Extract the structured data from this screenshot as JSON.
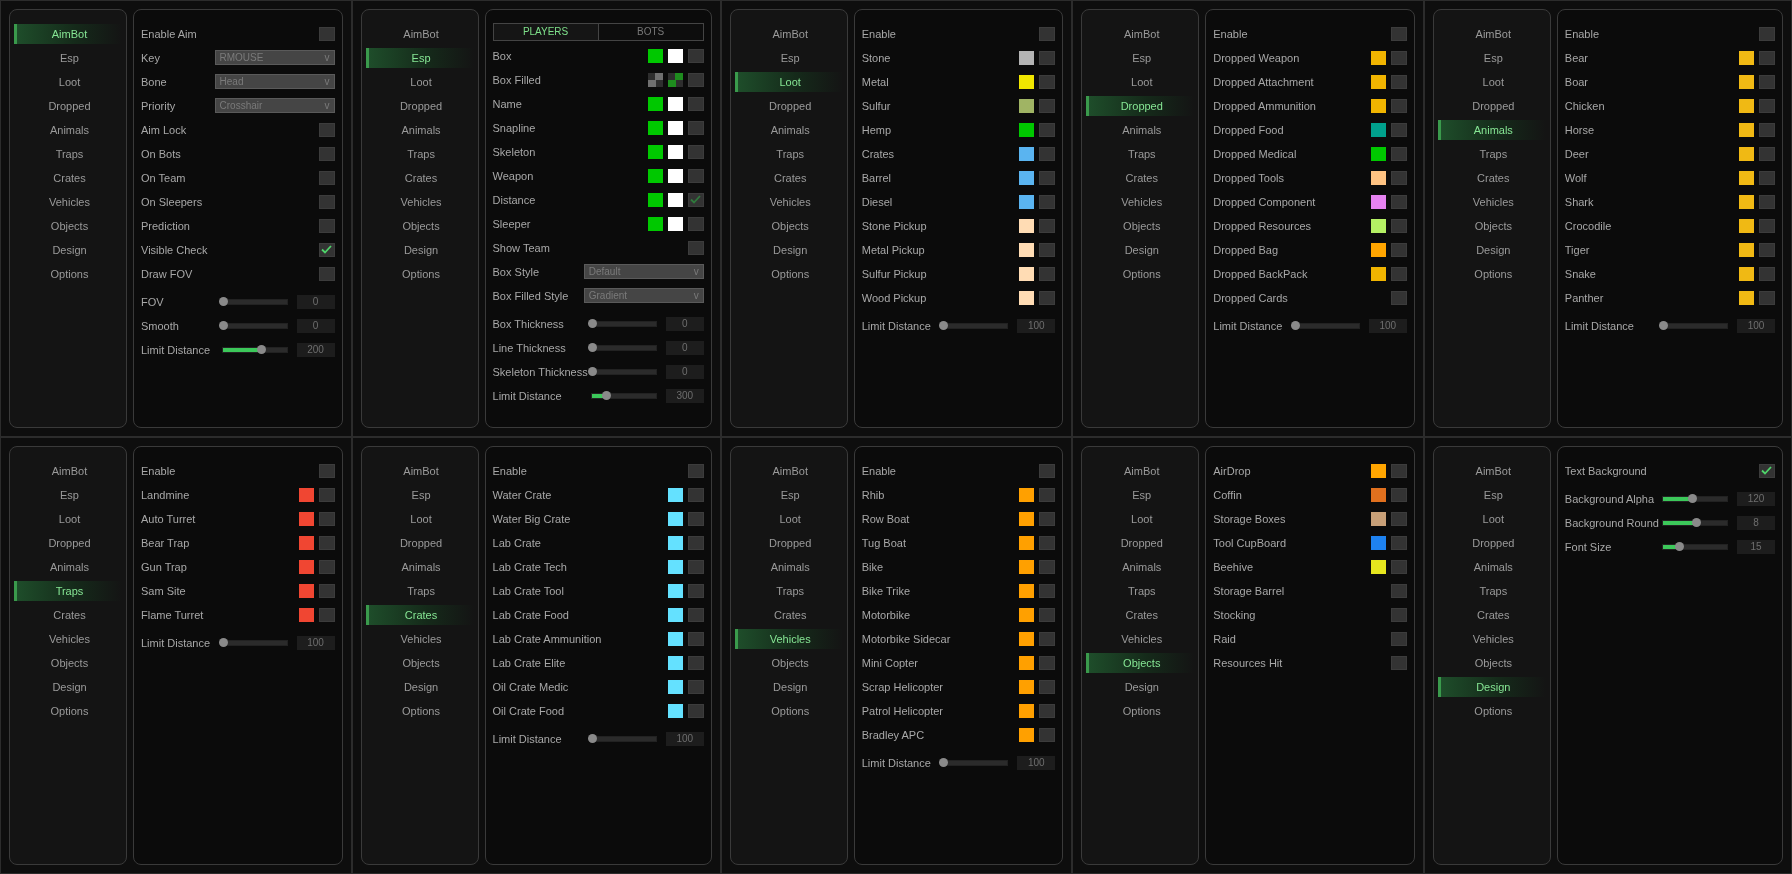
{
  "panels": [
    {
      "menu": [
        {
          "label": "AimBot",
          "selected": true
        },
        {
          "label": "Esp",
          "selected": false
        },
        {
          "label": "Loot",
          "selected": false
        },
        {
          "label": "Dropped",
          "selected": false
        },
        {
          "label": "Animals",
          "selected": false
        },
        {
          "label": "Traps",
          "selected": false
        },
        {
          "label": "Crates",
          "selected": false
        },
        {
          "label": "Vehicles",
          "selected": false
        },
        {
          "label": "Objects",
          "selected": false
        },
        {
          "label": "Design",
          "selected": false
        },
        {
          "label": "Options",
          "selected": false
        }
      ],
      "rows": [
        {
          "kind": "checkbox",
          "label": "Enable Aim",
          "checked": false
        },
        {
          "kind": "dropdown",
          "label": "Key",
          "value": "RMOUSE",
          "caret": "v"
        },
        {
          "kind": "dropdown",
          "label": "Bone",
          "value": "Head",
          "caret": "v"
        },
        {
          "kind": "dropdown",
          "label": "Priority",
          "value": "Crosshair",
          "caret": "v"
        },
        {
          "kind": "checkbox",
          "label": "Aim Lock",
          "checked": false
        },
        {
          "kind": "checkbox",
          "label": "On Bots",
          "checked": false
        },
        {
          "kind": "checkbox",
          "label": "On Team",
          "checked": false
        },
        {
          "kind": "checkbox",
          "label": "On Sleepers",
          "checked": false
        },
        {
          "kind": "checkbox",
          "label": "Prediction",
          "checked": false
        },
        {
          "kind": "checkbox",
          "label": "Visible Check",
          "checked": true
        },
        {
          "kind": "checkbox",
          "label": "Draw FOV",
          "checked": false
        },
        {
          "kind": "slider",
          "label": "FOV",
          "level": 0,
          "reading": "0"
        },
        {
          "kind": "slider",
          "label": "Smooth",
          "level": 0,
          "reading": "0"
        },
        {
          "kind": "slider",
          "label": "Limit Distance",
          "level": 0.6,
          "reading": "200"
        }
      ]
    },
    {
      "menu": [
        {
          "label": "AimBot",
          "selected": false
        },
        {
          "label": "Esp",
          "selected": true
        },
        {
          "label": "Loot",
          "selected": false
        },
        {
          "label": "Dropped",
          "selected": false
        },
        {
          "label": "Animals",
          "selected": false
        },
        {
          "label": "Traps",
          "selected": false
        },
        {
          "label": "Crates",
          "selected": false
        },
        {
          "label": "Vehicles",
          "selected": false
        },
        {
          "label": "Objects",
          "selected": false
        },
        {
          "label": "Design",
          "selected": false
        },
        {
          "label": "Options",
          "selected": false
        }
      ],
      "tabs": [
        {
          "label": "PLAYERS",
          "selected": true
        },
        {
          "label": "BOTS",
          "selected": false
        }
      ],
      "rows": [
        {
          "kind": "colors",
          "label": "Box",
          "swatches": [
            {
              "kind": "solid",
              "color": "#00c800"
            },
            {
              "kind": "solid",
              "color": "#ffffff"
            }
          ],
          "checked": false
        },
        {
          "kind": "colors",
          "label": "Box Filled",
          "swatches": [
            {
              "kind": "checker",
              "color": "#707070"
            },
            {
              "kind": "checker",
              "color": "#1e8c1e"
            }
          ],
          "checked": false
        },
        {
          "kind": "colors",
          "label": "Name",
          "swatches": [
            {
              "kind": "solid",
              "color": "#00c800"
            },
            {
              "kind": "solid",
              "color": "#ffffff"
            }
          ],
          "checked": false
        },
        {
          "kind": "colors",
          "label": "Snapline",
          "swatches": [
            {
              "kind": "solid",
              "color": "#00c800"
            },
            {
              "kind": "solid",
              "color": "#ffffff"
            }
          ],
          "checked": false
        },
        {
          "kind": "colors",
          "label": "Skeleton",
          "swatches": [
            {
              "kind": "solid",
              "color": "#00c800"
            },
            {
              "kind": "solid",
              "color": "#ffffff"
            }
          ],
          "checked": false
        },
        {
          "kind": "colors",
          "label": "Weapon",
          "swatches": [
            {
              "kind": "solid",
              "color": "#00c800"
            },
            {
              "kind": "solid",
              "color": "#ffffff"
            }
          ],
          "checked": false
        },
        {
          "kind": "colors",
          "label": "Distance",
          "swatches": [
            {
              "kind": "solid",
              "color": "#00c800"
            },
            {
              "kind": "solid",
              "color": "#ffffff"
            }
          ],
          "checked": true
        },
        {
          "kind": "colors",
          "label": "Sleeper",
          "swatches": [
            {
              "kind": "solid",
              "color": "#00c800"
            },
            {
              "kind": "solid",
              "color": "#ffffff"
            }
          ],
          "checked": false
        },
        {
          "kind": "checkbox",
          "label": "Show Team",
          "checked": false
        },
        {
          "kind": "dropdown",
          "label": "Box Style",
          "value": "Default",
          "caret": "v"
        },
        {
          "kind": "dropdown",
          "label": "Box Filled Style",
          "value": "Gradient",
          "caret": "v"
        },
        {
          "kind": "slider",
          "label": "Box Thickness",
          "level": 0,
          "reading": "0"
        },
        {
          "kind": "slider",
          "label": "Line Thickness",
          "level": 0,
          "reading": "0"
        },
        {
          "kind": "slider",
          "label": "Skeleton Thickness",
          "level": 0,
          "reading": "0"
        },
        {
          "kind": "slider",
          "label": "Limit Distance",
          "level": 0.22,
          "reading": "300"
        }
      ]
    },
    {
      "menu": [
        {
          "label": "AimBot",
          "selected": false
        },
        {
          "label": "Esp",
          "selected": false
        },
        {
          "label": "Loot",
          "selected": true
        },
        {
          "label": "Dropped",
          "selected": false
        },
        {
          "label": "Animals",
          "selected": false
        },
        {
          "label": "Traps",
          "selected": false
        },
        {
          "label": "Crates",
          "selected": false
        },
        {
          "label": "Vehicles",
          "selected": false
        },
        {
          "label": "Objects",
          "selected": false
        },
        {
          "label": "Design",
          "selected": false
        },
        {
          "label": "Options",
          "selected": false
        }
      ],
      "rows": [
        {
          "kind": "checkbox",
          "label": "Enable",
          "checked": false
        },
        {
          "kind": "colors",
          "label": "Stone",
          "swatches": [
            {
              "kind": "solid",
              "color": "#b4b4b4"
            }
          ],
          "checked": false
        },
        {
          "kind": "colors",
          "label": "Metal",
          "swatches": [
            {
              "kind": "solid",
              "color": "#f0e600"
            }
          ],
          "checked": false
        },
        {
          "kind": "colors",
          "label": "Sulfur",
          "swatches": [
            {
              "kind": "solid",
              "color": "#a0b464"
            }
          ],
          "checked": false
        },
        {
          "kind": "colors",
          "label": "Hemp",
          "swatches": [
            {
              "kind": "solid",
              "color": "#00c800"
            }
          ],
          "checked": false
        },
        {
          "kind": "colors",
          "label": "Crates",
          "swatches": [
            {
              "kind": "solid",
              "color": "#5ab4f0"
            }
          ],
          "checked": false
        },
        {
          "kind": "colors",
          "label": "Barrel",
          "swatches": [
            {
              "kind": "solid",
              "color": "#5ab4f0"
            }
          ],
          "checked": false
        },
        {
          "kind": "colors",
          "label": "Diesel",
          "swatches": [
            {
              "kind": "solid",
              "color": "#5ab4f0"
            }
          ],
          "checked": false
        },
        {
          "kind": "colors",
          "label": "Stone Pickup",
          "swatches": [
            {
              "kind": "solid",
              "color": "#ffdcb4"
            }
          ],
          "checked": false
        },
        {
          "kind": "colors",
          "label": "Metal Pickup",
          "swatches": [
            {
              "kind": "solid",
              "color": "#ffdcb4"
            }
          ],
          "checked": false
        },
        {
          "kind": "colors",
          "label": "Sulfur Pickup",
          "swatches": [
            {
              "kind": "solid",
              "color": "#ffdcb4"
            }
          ],
          "checked": false
        },
        {
          "kind": "colors",
          "label": "Wood Pickup",
          "swatches": [
            {
              "kind": "solid",
              "color": "#ffdcb4"
            }
          ],
          "checked": false
        },
        {
          "kind": "slider",
          "label": "Limit Distance",
          "level": 0,
          "reading": "100"
        }
      ]
    },
    {
      "menu": [
        {
          "label": "AimBot",
          "selected": false
        },
        {
          "label": "Esp",
          "selected": false
        },
        {
          "label": "Loot",
          "selected": false
        },
        {
          "label": "Dropped",
          "selected": true
        },
        {
          "label": "Animals",
          "selected": false
        },
        {
          "label": "Traps",
          "selected": false
        },
        {
          "label": "Crates",
          "selected": false
        },
        {
          "label": "Vehicles",
          "selected": false
        },
        {
          "label": "Objects",
          "selected": false
        },
        {
          "label": "Design",
          "selected": false
        },
        {
          "label": "Options",
          "selected": false
        }
      ],
      "rows": [
        {
          "kind": "checkbox",
          "label": "Enable",
          "checked": false
        },
        {
          "kind": "colors",
          "label": "Dropped Weapon",
          "swatches": [
            {
              "kind": "solid",
              "color": "#f0b400"
            }
          ],
          "checked": false
        },
        {
          "kind": "colors",
          "label": "Dropped Attachment",
          "swatches": [
            {
              "kind": "solid",
              "color": "#f0b400"
            }
          ],
          "checked": false
        },
        {
          "kind": "colors",
          "label": "Dropped Ammunition",
          "swatches": [
            {
              "kind": "solid",
              "color": "#f0b400"
            }
          ],
          "checked": false
        },
        {
          "kind": "colors",
          "label": "Dropped Food",
          "swatches": [
            {
              "kind": "solid",
              "color": "#00a08c"
            }
          ],
          "checked": false
        },
        {
          "kind": "colors",
          "label": "Dropped Medical",
          "swatches": [
            {
              "kind": "solid",
              "color": "#00c800"
            }
          ],
          "checked": false
        },
        {
          "kind": "colors",
          "label": "Dropped Tools",
          "swatches": [
            {
              "kind": "solid",
              "color": "#ffc382"
            }
          ],
          "checked": false
        },
        {
          "kind": "colors",
          "label": "Dropped Component",
          "swatches": [
            {
              "kind": "solid",
              "color": "#e682f0"
            }
          ],
          "checked": false
        },
        {
          "kind": "colors",
          "label": "Dropped Resources",
          "swatches": [
            {
              "kind": "solid",
              "color": "#b4f064"
            }
          ],
          "checked": false
        },
        {
          "kind": "colors",
          "label": "Dropped Bag",
          "swatches": [
            {
              "kind": "solid",
              "color": "#ffa500"
            }
          ],
          "checked": false
        },
        {
          "kind": "colors",
          "label": "Dropped BackPack",
          "swatches": [
            {
              "kind": "solid",
              "color": "#f0b400"
            }
          ],
          "checked": false
        },
        {
          "kind": "checkbox",
          "label": "Dropped Cards",
          "checked": false
        },
        {
          "kind": "slider",
          "label": "Limit Distance",
          "level": 0,
          "reading": "100"
        }
      ]
    },
    {
      "menu": [
        {
          "label": "AimBot",
          "selected": false
        },
        {
          "label": "Esp",
          "selected": false
        },
        {
          "label": "Loot",
          "selected": false
        },
        {
          "label": "Dropped",
          "selected": false
        },
        {
          "label": "Animals",
          "selected": true
        },
        {
          "label": "Traps",
          "selected": false
        },
        {
          "label": "Crates",
          "selected": false
        },
        {
          "label": "Vehicles",
          "selected": false
        },
        {
          "label": "Objects",
          "selected": false
        },
        {
          "label": "Design",
          "selected": false
        },
        {
          "label": "Options",
          "selected": false
        }
      ],
      "rows": [
        {
          "kind": "checkbox",
          "label": "Enable",
          "checked": false
        },
        {
          "kind": "colors",
          "label": "Bear",
          "swatches": [
            {
              "kind": "solid",
              "color": "#f0b914"
            }
          ],
          "checked": false
        },
        {
          "kind": "colors",
          "label": "Boar",
          "swatches": [
            {
              "kind": "solid",
              "color": "#f0b914"
            }
          ],
          "checked": false
        },
        {
          "kind": "colors",
          "label": "Chicken",
          "swatches": [
            {
              "kind": "solid",
              "color": "#f0b914"
            }
          ],
          "checked": false
        },
        {
          "kind": "colors",
          "label": "Horse",
          "swatches": [
            {
              "kind": "solid",
              "color": "#f0b914"
            }
          ],
          "checked": false
        },
        {
          "kind": "colors",
          "label": "Deer",
          "swatches": [
            {
              "kind": "solid",
              "color": "#f0b914"
            }
          ],
          "checked": false
        },
        {
          "kind": "colors",
          "label": "Wolf",
          "swatches": [
            {
              "kind": "solid",
              "color": "#f0b914"
            }
          ],
          "checked": false
        },
        {
          "kind": "colors",
          "label": "Shark",
          "swatches": [
            {
              "kind": "solid",
              "color": "#f0b914"
            }
          ],
          "checked": false
        },
        {
          "kind": "colors",
          "label": "Crocodile",
          "swatches": [
            {
              "kind": "solid",
              "color": "#f0b914"
            }
          ],
          "checked": false
        },
        {
          "kind": "colors",
          "label": "Tiger",
          "swatches": [
            {
              "kind": "solid",
              "color": "#f0b914"
            }
          ],
          "checked": false
        },
        {
          "kind": "colors",
          "label": "Snake",
          "swatches": [
            {
              "kind": "solid",
              "color": "#f0b914"
            }
          ],
          "checked": false
        },
        {
          "kind": "colors",
          "label": "Panther",
          "swatches": [
            {
              "kind": "solid",
              "color": "#f0b914"
            }
          ],
          "checked": false
        },
        {
          "kind": "slider",
          "label": "Limit Distance",
          "level": 0,
          "reading": "100"
        }
      ]
    },
    {
      "menu": [
        {
          "label": "AimBot",
          "selected": false
        },
        {
          "label": "Esp",
          "selected": false
        },
        {
          "label": "Loot",
          "selected": false
        },
        {
          "label": "Dropped",
          "selected": false
        },
        {
          "label": "Animals",
          "selected": false
        },
        {
          "label": "Traps",
          "selected": true
        },
        {
          "label": "Crates",
          "selected": false
        },
        {
          "label": "Vehicles",
          "selected": false
        },
        {
          "label": "Objects",
          "selected": false
        },
        {
          "label": "Design",
          "selected": false
        },
        {
          "label": "Options",
          "selected": false
        }
      ],
      "rows": [
        {
          "kind": "checkbox",
          "label": "Enable",
          "checked": false
        },
        {
          "kind": "colors",
          "label": "Landmine",
          "swatches": [
            {
              "kind": "solid",
              "color": "#f04632"
            }
          ],
          "checked": false
        },
        {
          "kind": "colors",
          "label": "Auto Turret",
          "swatches": [
            {
              "kind": "solid",
              "color": "#f04632"
            }
          ],
          "checked": false
        },
        {
          "kind": "colors",
          "label": "Bear Trap",
          "swatches": [
            {
              "kind": "solid",
              "color": "#f04632"
            }
          ],
          "checked": false
        },
        {
          "kind": "colors",
          "label": "Gun Trap",
          "swatches": [
            {
              "kind": "solid",
              "color": "#f04632"
            }
          ],
          "checked": false
        },
        {
          "kind": "colors",
          "label": "Sam Site",
          "swatches": [
            {
              "kind": "solid",
              "color": "#f04632"
            }
          ],
          "checked": false
        },
        {
          "kind": "colors",
          "label": "Flame Turret",
          "swatches": [
            {
              "kind": "solid",
              "color": "#f04632"
            }
          ],
          "checked": false
        },
        {
          "kind": "slider",
          "label": "Limit Distance",
          "level": 0,
          "reading": "100"
        }
      ]
    },
    {
      "menu": [
        {
          "label": "AimBot",
          "selected": false
        },
        {
          "label": "Esp",
          "selected": false
        },
        {
          "label": "Loot",
          "selected": false
        },
        {
          "label": "Dropped",
          "selected": false
        },
        {
          "label": "Animals",
          "selected": false
        },
        {
          "label": "Traps",
          "selected": false
        },
        {
          "label": "Crates",
          "selected": true
        },
        {
          "label": "Vehicles",
          "selected": false
        },
        {
          "label": "Objects",
          "selected": false
        },
        {
          "label": "Design",
          "selected": false
        },
        {
          "label": "Options",
          "selected": false
        }
      ],
      "rows": [
        {
          "kind": "checkbox",
          "label": "Enable",
          "checked": false
        },
        {
          "kind": "colors",
          "label": "Water Crate",
          "swatches": [
            {
              "kind": "solid",
              "color": "#64e1ff"
            }
          ],
          "checked": false
        },
        {
          "kind": "colors",
          "label": "Water Big Crate",
          "swatches": [
            {
              "kind": "solid",
              "color": "#64e1ff"
            }
          ],
          "checked": false
        },
        {
          "kind": "colors",
          "label": "Lab Crate",
          "swatches": [
            {
              "kind": "solid",
              "color": "#64e1ff"
            }
          ],
          "checked": false
        },
        {
          "kind": "colors",
          "label": "Lab Crate Tech",
          "swatches": [
            {
              "kind": "solid",
              "color": "#64e1ff"
            }
          ],
          "checked": false
        },
        {
          "kind": "colors",
          "label": "Lab Crate Tool",
          "swatches": [
            {
              "kind": "solid",
              "color": "#64e1ff"
            }
          ],
          "checked": false
        },
        {
          "kind": "colors",
          "label": "Lab Crate Food",
          "swatches": [
            {
              "kind": "solid",
              "color": "#64e1ff"
            }
          ],
          "checked": false
        },
        {
          "kind": "colors",
          "label": "Lab Crate Ammunition",
          "swatches": [
            {
              "kind": "solid",
              "color": "#64e1ff"
            }
          ],
          "checked": false
        },
        {
          "kind": "colors",
          "label": "Lab Crate Elite",
          "swatches": [
            {
              "kind": "solid",
              "color": "#64e1ff"
            }
          ],
          "checked": false
        },
        {
          "kind": "colors",
          "label": "Oil Crate Medic",
          "swatches": [
            {
              "kind": "solid",
              "color": "#64e1ff"
            }
          ],
          "checked": false
        },
        {
          "kind": "colors",
          "label": "Oil Crate Food",
          "swatches": [
            {
              "kind": "solid",
              "color": "#64e1ff"
            }
          ],
          "checked": false
        },
        {
          "kind": "slider",
          "label": "Limit Distance",
          "level": 0,
          "reading": "100"
        }
      ]
    },
    {
      "menu": [
        {
          "label": "AimBot",
          "selected": false
        },
        {
          "label": "Esp",
          "selected": false
        },
        {
          "label": "Loot",
          "selected": false
        },
        {
          "label": "Dropped",
          "selected": false
        },
        {
          "label": "Animals",
          "selected": false
        },
        {
          "label": "Traps",
          "selected": false
        },
        {
          "label": "Crates",
          "selected": false
        },
        {
          "label": "Vehicles",
          "selected": true
        },
        {
          "label": "Objects",
          "selected": false
        },
        {
          "label": "Design",
          "selected": false
        },
        {
          "label": "Options",
          "selected": false
        }
      ],
      "rows": [
        {
          "kind": "checkbox",
          "label": "Enable",
          "checked": false
        },
        {
          "kind": "colors",
          "label": "Rhib",
          "swatches": [
            {
              "kind": "solid",
              "color": "#ffa000"
            }
          ],
          "checked": false
        },
        {
          "kind": "colors",
          "label": "Row Boat",
          "swatches": [
            {
              "kind": "solid",
              "color": "#ffa000"
            }
          ],
          "checked": false
        },
        {
          "kind": "colors",
          "label": "Tug Boat",
          "swatches": [
            {
              "kind": "solid",
              "color": "#ffa000"
            }
          ],
          "checked": false
        },
        {
          "kind": "colors",
          "label": "Bike",
          "swatches": [
            {
              "kind": "solid",
              "color": "#ffa000"
            }
          ],
          "checked": false
        },
        {
          "kind": "colors",
          "label": "Bike Trike",
          "swatches": [
            {
              "kind": "solid",
              "color": "#ffa000"
            }
          ],
          "checked": false
        },
        {
          "kind": "colors",
          "label": "Motorbike",
          "swatches": [
            {
              "kind": "solid",
              "color": "#ffa000"
            }
          ],
          "checked": false
        },
        {
          "kind": "colors",
          "label": "Motorbike Sidecar",
          "swatches": [
            {
              "kind": "solid",
              "color": "#ffa000"
            }
          ],
          "checked": false
        },
        {
          "kind": "colors",
          "label": "Mini Copter",
          "swatches": [
            {
              "kind": "solid",
              "color": "#ffa000"
            }
          ],
          "checked": false
        },
        {
          "kind": "colors",
          "label": "Scrap Helicopter",
          "swatches": [
            {
              "kind": "solid",
              "color": "#ffa000"
            }
          ],
          "checked": false
        },
        {
          "kind": "colors",
          "label": "Patrol Helicopter",
          "swatches": [
            {
              "kind": "solid",
              "color": "#ffa000"
            }
          ],
          "checked": false
        },
        {
          "kind": "colors",
          "label": "Bradley APC",
          "swatches": [
            {
              "kind": "solid",
              "color": "#ffa000"
            }
          ],
          "checked": false
        },
        {
          "kind": "slider",
          "label": "Limit Distance",
          "level": 0,
          "reading": "100"
        }
      ]
    },
    {
      "menu": [
        {
          "label": "AimBot",
          "selected": false
        },
        {
          "label": "Esp",
          "selected": false
        },
        {
          "label": "Loot",
          "selected": false
        },
        {
          "label": "Dropped",
          "selected": false
        },
        {
          "label": "Animals",
          "selected": false
        },
        {
          "label": "Traps",
          "selected": false
        },
        {
          "label": "Crates",
          "selected": false
        },
        {
          "label": "Vehicles",
          "selected": false
        },
        {
          "label": "Objects",
          "selected": true
        },
        {
          "label": "Design",
          "selected": false
        },
        {
          "label": "Options",
          "selected": false
        }
      ],
      "rows": [
        {
          "kind": "colors",
          "label": "AirDrop",
          "swatches": [
            {
              "kind": "solid",
              "color": "#ffa500"
            }
          ],
          "checked": false
        },
        {
          "kind": "colors",
          "label": "Coffin",
          "swatches": [
            {
              "kind": "solid",
              "color": "#e0701e"
            }
          ],
          "checked": false
        },
        {
          "kind": "colors",
          "label": "Storage Boxes",
          "swatches": [
            {
              "kind": "solid",
              "color": "#c8a078"
            }
          ],
          "checked": false
        },
        {
          "kind": "colors",
          "label": "Tool CupBoard",
          "swatches": [
            {
              "kind": "solid",
              "color": "#1e82f0"
            }
          ],
          "checked": false
        },
        {
          "kind": "colors",
          "label": "Beehive",
          "swatches": [
            {
              "kind": "solid",
              "color": "#e6e61e"
            }
          ],
          "checked": false
        },
        {
          "kind": "checkbox",
          "label": "Storage Barrel",
          "checked": false
        },
        {
          "kind": "checkbox",
          "label": "Stocking",
          "checked": false
        },
        {
          "kind": "checkbox",
          "label": "Raid",
          "checked": false
        },
        {
          "kind": "checkbox",
          "label": "Resources Hit",
          "checked": false
        }
      ]
    },
    {
      "menu": [
        {
          "label": "AimBot",
          "selected": false
        },
        {
          "label": "Esp",
          "selected": false
        },
        {
          "label": "Loot",
          "selected": false
        },
        {
          "label": "Dropped",
          "selected": false
        },
        {
          "label": "Animals",
          "selected": false
        },
        {
          "label": "Traps",
          "selected": false
        },
        {
          "label": "Crates",
          "selected": false
        },
        {
          "label": "Vehicles",
          "selected": false
        },
        {
          "label": "Objects",
          "selected": false
        },
        {
          "label": "Design",
          "selected": true
        },
        {
          "label": "Options",
          "selected": false
        }
      ],
      "rows": [
        {
          "kind": "checkbox",
          "label": "Text Background",
          "checked": true
        },
        {
          "kind": "slider",
          "label": "Background Alpha",
          "level": 0.45,
          "reading": "120"
        },
        {
          "kind": "slider",
          "label": "Background Round",
          "level": 0.52,
          "reading": "8"
        },
        {
          "kind": "slider",
          "label": "Font Size",
          "level": 0.25,
          "reading": "15"
        }
      ]
    }
  ]
}
